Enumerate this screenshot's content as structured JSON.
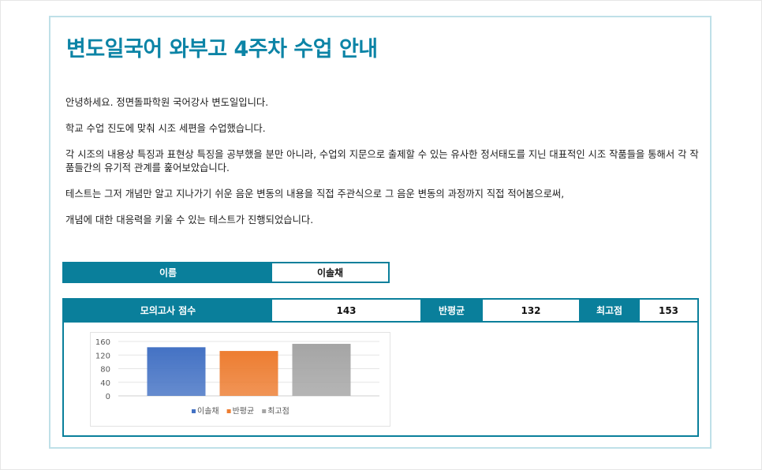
{
  "title": "변도일국어 와부고 4주차 수업 안내",
  "paragraphs": [
    "안녕하세요. 정면돌파학원 국어강사 변도일입니다.",
    "학교 수업 진도에 맞춰 시조 세편을 수업했습니다.",
    "각 시조의 내용상 특징과 표현상 특징을 공부했을 분만 아니라, 수업외 지문으로 출제할 수 있는 유사한 정서태도를 지닌 대표적인 시조 작품들을 통해서 각 작품들간의 유기적 관계를 훑어보았습니다.",
    "테스트는 그저 개념만 알고 지나가기 쉬운 음운 변동의 내용을 직접 주관식으로 그 음운 변동의 과정까지 직접 적어봄으로써,",
    "개념에 대한 대응력을 키울 수 있는 테스트가 진행되었습니다."
  ],
  "student": {
    "label": "이름",
    "value": "이솔채"
  },
  "scores": {
    "mock_label": "모의고사 점수",
    "mock_value": "143",
    "avg_label": "반평균",
    "avg_value": "132",
    "max_label": "최고점",
    "max_value": "153"
  },
  "chart_data": {
    "type": "bar",
    "categories": [
      ""
    ],
    "series": [
      {
        "name": "이솔채",
        "values": [
          143
        ],
        "color": "#4472c4"
      },
      {
        "name": "반평균",
        "values": [
          132
        ],
        "color": "#ed7d31"
      },
      {
        "name": "최고점",
        "values": [
          153
        ],
        "color": "#a5a5a5"
      }
    ],
    "yticks": [
      "0",
      "40",
      "80",
      "120",
      "160"
    ],
    "ylim": [
      0,
      160
    ],
    "grid": true,
    "legend": "bottom"
  }
}
